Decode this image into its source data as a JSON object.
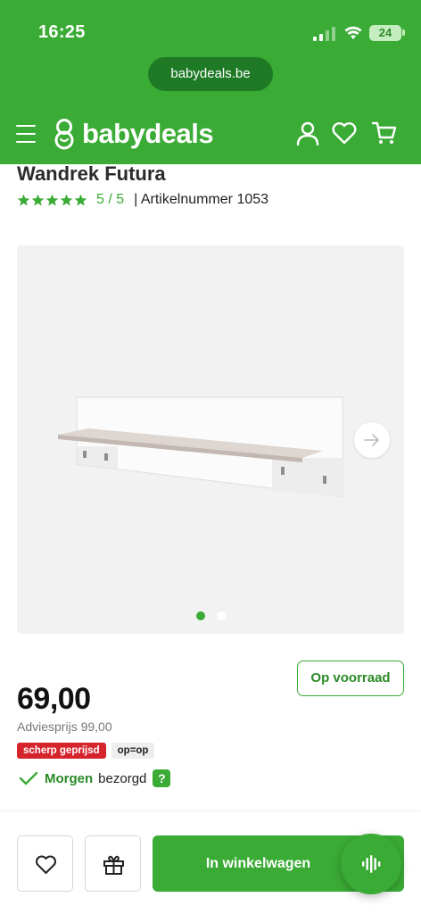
{
  "status_bar": {
    "time": "16:25",
    "battery": "24"
  },
  "browser": {
    "url": "babydeals.be"
  },
  "header": {
    "logo_text": "babydeals",
    "icons": [
      "menu-icon",
      "account-icon",
      "heart-icon",
      "cart-icon"
    ]
  },
  "product": {
    "title": "Wandrek Futura",
    "rating_stars": 5,
    "rating": "5 / 5",
    "article_number": "| Artikelnummer 1053"
  },
  "gallery": {
    "image_count": 2,
    "active_index": 0
  },
  "stock_label": "Op voorraad",
  "price": "69,00",
  "advice_price": "Adviesprijs 99,00",
  "tags": [
    "scherp geprijsd",
    "op=op"
  ],
  "delivery": {
    "when": "Morgen",
    "status": "bezorgd",
    "help": "?"
  },
  "actions": {
    "add_to_cart": "In winkelwagen"
  },
  "colors": {
    "brand_green": "#3aab35",
    "dark_green": "#1e7a25",
    "tag_red": "#d6242c"
  }
}
